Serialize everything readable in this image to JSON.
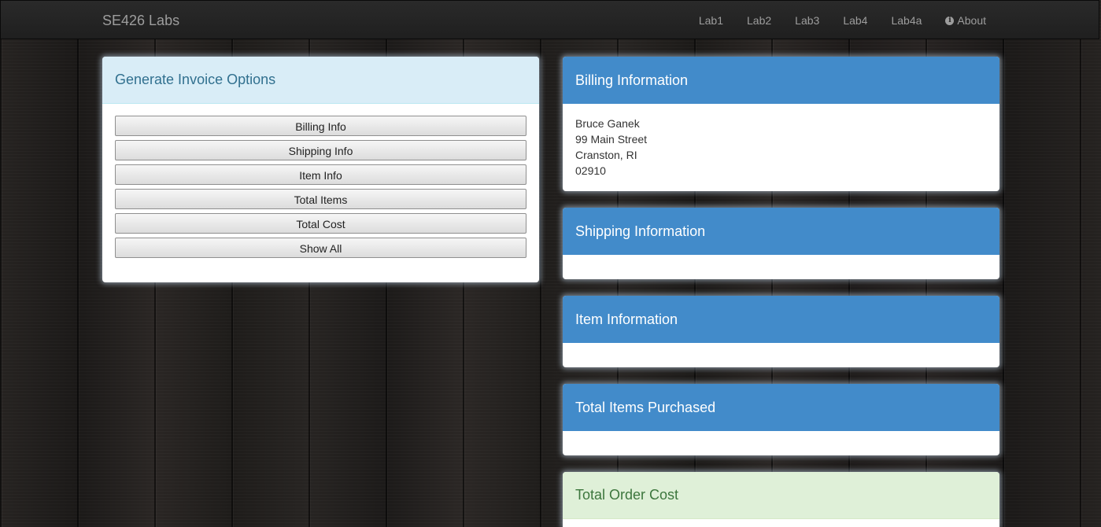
{
  "navbar": {
    "brand": "SE426 Labs",
    "links": [
      {
        "label": "Lab1"
      },
      {
        "label": "Lab2"
      },
      {
        "label": "Lab3"
      },
      {
        "label": "Lab4"
      },
      {
        "label": "Lab4a"
      },
      {
        "label": "About",
        "icon": "info-circle-icon"
      }
    ]
  },
  "options_panel": {
    "title": "Generate Invoice Options",
    "buttons": [
      "Billing Info",
      "Shipping Info",
      "Item Info",
      "Total Items",
      "Total Cost",
      "Show All"
    ]
  },
  "billing_panel": {
    "title": "Billing Information",
    "lines": [
      "Bruce Ganek",
      "99 Main Street",
      "Cranston, RI",
      "02910"
    ]
  },
  "shipping_panel": {
    "title": "Shipping Information"
  },
  "item_panel": {
    "title": "Item Information"
  },
  "total_items_panel": {
    "title": "Total Items Purchased"
  },
  "total_cost_panel": {
    "title": "Total Order Cost"
  },
  "colors": {
    "primary_heading": "#428bca",
    "info_heading": "#d9edf7",
    "success_heading": "#dff0d8",
    "navbar": "#222222"
  }
}
